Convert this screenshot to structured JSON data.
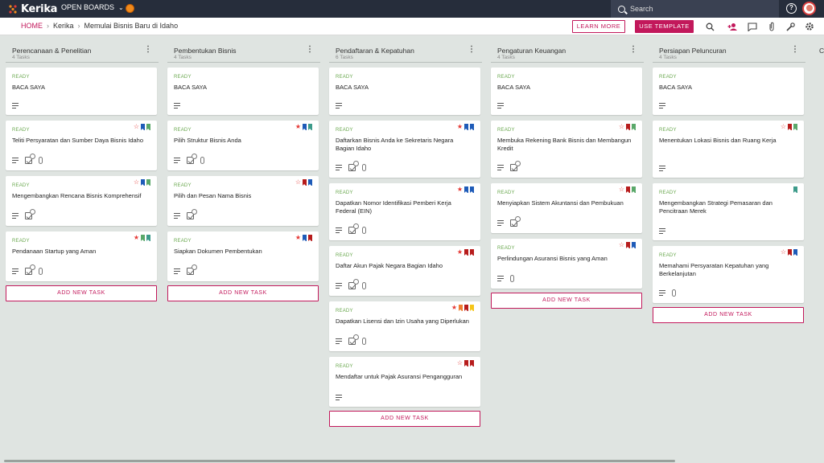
{
  "app": {
    "name": "Kerika",
    "open_boards_label": "OPEN BOARDS",
    "search_placeholder": "Search"
  },
  "breadcrumb": {
    "home": "HOME",
    "org": "Kerika",
    "board": "Memulai Bisnis Baru di Idaho"
  },
  "actions": {
    "learn_more": "LEARN MORE",
    "use_template": "USE TEMPLATE"
  },
  "add_task_label": "ADD NEW TASK",
  "colors": {
    "accent": "#c2185b",
    "topbar": "#262d3b",
    "status_ready": "#6aa84f",
    "flag_red": "#e53935",
    "flag_blue": "#1e5bb8",
    "flag_green": "#5aa86a",
    "flag_orange": "#ef7d31",
    "flag_yellow": "#f5c518",
    "flag_teal": "#3d9b8a",
    "flag_darkred": "#b71c1c"
  },
  "columns": [
    {
      "title": "Perencanaan & Penelitian",
      "count": "4 Tasks",
      "cards": [
        {
          "status": "READY",
          "title": "BACA SAYA",
          "flags": [],
          "icons": [
            "desc"
          ]
        },
        {
          "status": "READY",
          "title": "Teliti Persyaratan dan Sumber Daya Bisnis Idaho",
          "flags": [
            "star-outline",
            "blue",
            "green"
          ],
          "icons": [
            "desc",
            "check:4",
            "clip"
          ]
        },
        {
          "status": "READY",
          "title": "Mengembangkan Rencana Bisnis Komprehensif",
          "flags": [
            "star-outline",
            "blue",
            "green"
          ],
          "icons": [
            "desc",
            "check:3"
          ]
        },
        {
          "status": "READY",
          "title": "Pendanaan Startup yang Aman",
          "flags": [
            "star",
            "green",
            "teal"
          ],
          "icons": [
            "desc",
            "check:3",
            "clip"
          ]
        }
      ]
    },
    {
      "title": "Pembentukan Bisnis",
      "count": "4 Tasks",
      "cards": [
        {
          "status": "READY",
          "title": "BACA SAYA",
          "flags": [],
          "icons": [
            "desc"
          ]
        },
        {
          "status": "READY",
          "title": "Pilih Struktur Bisnis Anda",
          "flags": [
            "star",
            "blue",
            "teal"
          ],
          "icons": [
            "desc",
            "check:3",
            "clip"
          ]
        },
        {
          "status": "READY",
          "title": "Pilih dan Pesan Nama Bisnis",
          "flags": [
            "star-outline",
            "darkred",
            "blue"
          ],
          "icons": [
            "desc",
            "check:3"
          ]
        },
        {
          "status": "READY",
          "title": "Siapkan Dokumen Pembentukan",
          "flags": [
            "star",
            "blue",
            "darkred"
          ],
          "icons": [
            "desc",
            "check:3"
          ]
        }
      ]
    },
    {
      "title": "Pendaftaran & Kepatuhan",
      "count": "6 Tasks",
      "cards": [
        {
          "status": "READY",
          "title": "BACA SAYA",
          "flags": [],
          "icons": [
            "desc"
          ]
        },
        {
          "status": "READY",
          "title": "Daftarkan Bisnis Anda ke Sekretaris Negara Bagian Idaho",
          "flags": [
            "star",
            "blue",
            "blue"
          ],
          "icons": [
            "desc",
            "check:3",
            "clip"
          ]
        },
        {
          "status": "READY",
          "title": "Dapatkan Nomor Identifikasi Pemberi Kerja Federal (EIN)",
          "flags": [
            "star",
            "blue",
            "blue"
          ],
          "icons": [
            "desc",
            "check:3",
            "clip"
          ]
        },
        {
          "status": "READY",
          "title": "Daftar Akun Pajak Negara Bagian Idaho",
          "flags": [
            "star",
            "darkred",
            "darkred"
          ],
          "icons": [
            "desc",
            "check:3",
            "clip"
          ]
        },
        {
          "status": "READY",
          "title": "Dapatkan Lisensi dan Izin Usaha yang Diperlukan",
          "flags": [
            "star",
            "orange",
            "darkred",
            "yellow"
          ],
          "icons": [
            "desc",
            "check:3",
            "clip"
          ]
        },
        {
          "status": "READY",
          "title": "Mendaftar untuk Pajak Asuransi Pengangguran",
          "flags": [
            "star-outline",
            "darkred",
            "darkred"
          ],
          "icons": [
            "desc"
          ]
        }
      ]
    },
    {
      "title": "Pengaturan Keuangan",
      "count": "4 Tasks",
      "cards": [
        {
          "status": "READY",
          "title": "BACA SAYA",
          "flags": [],
          "icons": [
            "desc"
          ]
        },
        {
          "status": "READY",
          "title": "Membuka Rekening Bank Bisnis dan Membangun Kredit",
          "flags": [
            "star-outline",
            "darkred",
            "green"
          ],
          "icons": [
            "desc",
            "check:3"
          ]
        },
        {
          "status": "READY",
          "title": "Menyiapkan Sistem Akuntansi dan Pembukuan",
          "flags": [
            "star-outline",
            "darkred",
            "green"
          ],
          "icons": [
            "desc",
            "check:3"
          ]
        },
        {
          "status": "READY",
          "title": "Perlindungan Asuransi Bisnis yang Aman",
          "flags": [
            "star-outline",
            "darkred",
            "blue"
          ],
          "icons": [
            "desc",
            "clip"
          ]
        }
      ]
    },
    {
      "title": "Persiapan Peluncuran",
      "count": "4 Tasks",
      "cards": [
        {
          "status": "READY",
          "title": "BACA SAYA",
          "flags": [],
          "icons": [
            "desc"
          ]
        },
        {
          "status": "READY",
          "title": "Menentukan Lokasi Bisnis dan Ruang Kerja",
          "flags": [
            "star-outline",
            "darkred",
            "green"
          ],
          "icons": [
            "desc"
          ]
        },
        {
          "status": "READY",
          "title": "Mengembangkan Strategi Pemasaran dan Pencitraan Merek",
          "flags": [
            "teal"
          ],
          "icons": [
            "desc"
          ]
        },
        {
          "status": "READY",
          "title": "Memahami Persyaratan Kepatuhan yang Berkelanjutan",
          "flags": [
            "star-outline",
            "darkred",
            "blue"
          ],
          "icons": [
            "desc",
            "clip"
          ]
        }
      ]
    }
  ],
  "next_column_stub": "C"
}
